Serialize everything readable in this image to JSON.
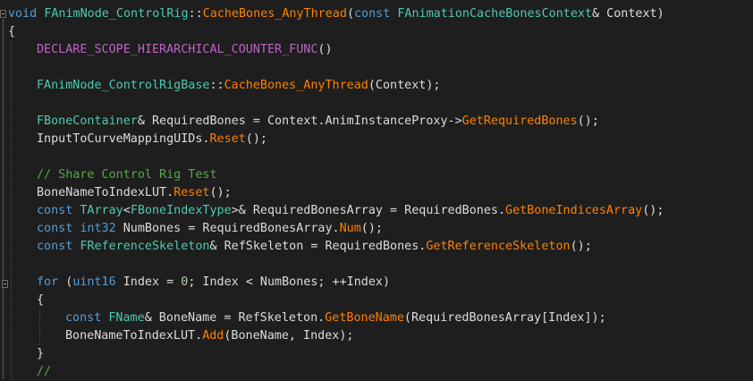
{
  "code_lines": [
    {
      "indent": 0,
      "tokens": [
        {
          "t": "void",
          "c": "kw"
        },
        {
          "t": " ",
          "c": "pl"
        },
        {
          "t": "FAnimNode_ControlRig",
          "c": "ty"
        },
        {
          "t": "::",
          "c": "pl"
        },
        {
          "t": "CacheBones_AnyThread",
          "c": "fn"
        },
        {
          "t": "(",
          "c": "pl"
        },
        {
          "t": "const",
          "c": "kw"
        },
        {
          "t": " ",
          "c": "pl"
        },
        {
          "t": "FAnimationCacheBonesContext",
          "c": "ty"
        },
        {
          "t": "& Context)",
          "c": "pl"
        }
      ]
    },
    {
      "indent": 0,
      "tokens": [
        {
          "t": "{",
          "c": "pl"
        }
      ]
    },
    {
      "indent": 1,
      "tokens": [
        {
          "t": "DECLARE_SCOPE_HIERARCHICAL_COUNTER_FUNC",
          "c": "mc"
        },
        {
          "t": "()",
          "c": "pl"
        }
      ]
    },
    {
      "indent": 0,
      "tokens": []
    },
    {
      "indent": 1,
      "tokens": [
        {
          "t": "FAnimNode_ControlRigBase",
          "c": "ty"
        },
        {
          "t": "::",
          "c": "pl"
        },
        {
          "t": "CacheBones_AnyThread",
          "c": "fn"
        },
        {
          "t": "(Context);",
          "c": "pl"
        }
      ]
    },
    {
      "indent": 0,
      "tokens": []
    },
    {
      "indent": 1,
      "tokens": [
        {
          "t": "FBoneContainer",
          "c": "ty"
        },
        {
          "t": "& RequiredBones = Context.AnimInstanceProxy->",
          "c": "pl"
        },
        {
          "t": "GetRequiredBones",
          "c": "fn"
        },
        {
          "t": "();",
          "c": "pl"
        }
      ]
    },
    {
      "indent": 1,
      "tokens": [
        {
          "t": "InputToCurveMappingUIDs.",
          "c": "pl"
        },
        {
          "t": "Reset",
          "c": "fn"
        },
        {
          "t": "();",
          "c": "pl"
        }
      ]
    },
    {
      "indent": 0,
      "tokens": []
    },
    {
      "indent": 1,
      "tokens": [
        {
          "t": "// Share Control Rig Test",
          "c": "cm"
        }
      ]
    },
    {
      "indent": 1,
      "tokens": [
        {
          "t": "BoneNameToIndexLUT.",
          "c": "pl"
        },
        {
          "t": "Reset",
          "c": "fn"
        },
        {
          "t": "();",
          "c": "pl"
        }
      ]
    },
    {
      "indent": 1,
      "tokens": [
        {
          "t": "const",
          "c": "kw"
        },
        {
          "t": " ",
          "c": "pl"
        },
        {
          "t": "TArray",
          "c": "ty"
        },
        {
          "t": "<",
          "c": "pl"
        },
        {
          "t": "FBoneIndexType",
          "c": "ty"
        },
        {
          "t": ">& RequiredBonesArray = RequiredBones.",
          "c": "pl"
        },
        {
          "t": "GetBoneIndicesArray",
          "c": "fn"
        },
        {
          "t": "();",
          "c": "pl"
        }
      ]
    },
    {
      "indent": 1,
      "tokens": [
        {
          "t": "const",
          "c": "kw"
        },
        {
          "t": " ",
          "c": "pl"
        },
        {
          "t": "int32",
          "c": "kw"
        },
        {
          "t": " NumBones = RequiredBonesArray.",
          "c": "pl"
        },
        {
          "t": "Num",
          "c": "fn"
        },
        {
          "t": "();",
          "c": "pl"
        }
      ]
    },
    {
      "indent": 1,
      "tokens": [
        {
          "t": "const",
          "c": "kw"
        },
        {
          "t": " ",
          "c": "pl"
        },
        {
          "t": "FReferenceSkeleton",
          "c": "ty"
        },
        {
          "t": "& RefSkeleton = RequiredBones.",
          "c": "pl"
        },
        {
          "t": "GetReferenceSkeleton",
          "c": "fn"
        },
        {
          "t": "();",
          "c": "pl"
        }
      ]
    },
    {
      "indent": 0,
      "tokens": []
    },
    {
      "indent": 1,
      "tokens": [
        {
          "t": "for",
          "c": "kw"
        },
        {
          "t": " (",
          "c": "pl"
        },
        {
          "t": "uint16",
          "c": "kw"
        },
        {
          "t": " Index = ",
          "c": "pl"
        },
        {
          "t": "0",
          "c": "nm"
        },
        {
          "t": "; Index < NumBones; ++Index)",
          "c": "pl"
        }
      ]
    },
    {
      "indent": 1,
      "tokens": [
        {
          "t": "{",
          "c": "pl"
        }
      ]
    },
    {
      "indent": 2,
      "tokens": [
        {
          "t": "const",
          "c": "kw"
        },
        {
          "t": " ",
          "c": "pl"
        },
        {
          "t": "FName",
          "c": "ty"
        },
        {
          "t": "& BoneName = RefSkeleton.",
          "c": "pl"
        },
        {
          "t": "GetBoneName",
          "c": "fn"
        },
        {
          "t": "(RequiredBonesArray[Index]);",
          "c": "pl"
        }
      ]
    },
    {
      "indent": 2,
      "tokens": [
        {
          "t": "BoneNameToIndexLUT.",
          "c": "pl"
        },
        {
          "t": "Add",
          "c": "fn"
        },
        {
          "t": "(BoneName, Index);",
          "c": "pl"
        }
      ]
    },
    {
      "indent": 1,
      "tokens": [
        {
          "t": "}",
          "c": "pl"
        }
      ]
    },
    {
      "indent": 1,
      "tokens": [
        {
          "t": "//",
          "c": "cm"
        }
      ]
    }
  ]
}
